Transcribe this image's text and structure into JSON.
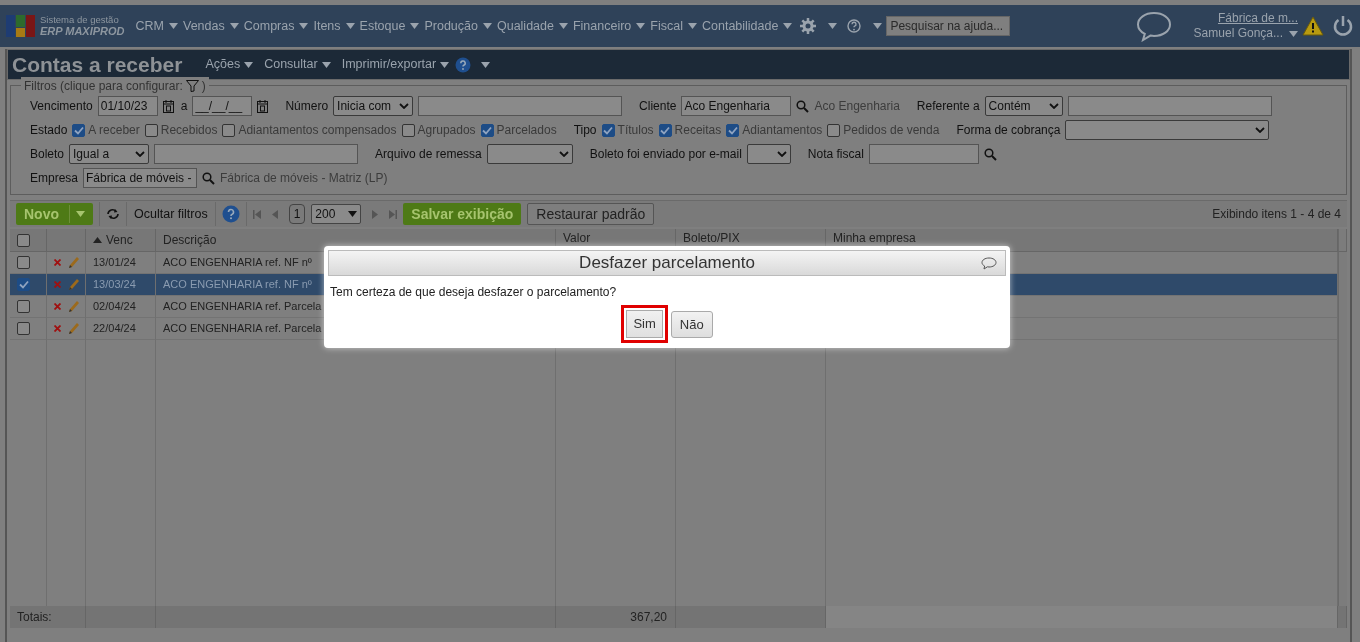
{
  "brand": {
    "line1": "Sistema de gestão",
    "line2": "ERP MAXIPROD"
  },
  "menu": [
    {
      "label": "CRM"
    },
    {
      "label": "Vendas"
    },
    {
      "label": "Compras"
    },
    {
      "label": "Itens"
    },
    {
      "label": "Estoque"
    },
    {
      "label": "Produção"
    },
    {
      "label": "Qualidade"
    },
    {
      "label": "Financeiro"
    },
    {
      "label": "Fiscal"
    },
    {
      "label": "Contabilidade"
    }
  ],
  "help_search": {
    "placeholder": "Pesquisar na ajuda..."
  },
  "account": {
    "company": "Fábrica de m...",
    "user": "Samuel Gonça..."
  },
  "page": {
    "title": "Contas a receber",
    "actions": [
      {
        "label": "Ações"
      },
      {
        "label": "Consultar"
      },
      {
        "label": "Imprimir/exportar"
      }
    ]
  },
  "filters": {
    "legend": "Filtros (clique para configurar:",
    "legend_end": ")",
    "lines": [
      {
        "items": [
          {
            "kind": "label",
            "text": "Vencimento"
          },
          {
            "kind": "date",
            "value": "01/10/23"
          },
          {
            "kind": "label",
            "text": "a"
          },
          {
            "kind": "date",
            "value": "__/__/__"
          },
          {
            "kind": "label",
            "text": "Número"
          },
          {
            "kind": "select",
            "value": "Inicia com"
          },
          {
            "kind": "input"
          },
          {
            "kind": "label",
            "text": "Cliente"
          },
          {
            "kind": "input",
            "value": "Aco Engenharia"
          },
          {
            "kind": "search"
          },
          {
            "kind": "text",
            "text": "Aco Engenharia"
          },
          {
            "kind": "label",
            "text": "Referente a"
          },
          {
            "kind": "select",
            "value": "Contém"
          },
          {
            "kind": "input"
          }
        ]
      },
      {
        "items": [
          {
            "kind": "label",
            "text": "Estado"
          },
          {
            "kind": "checkbox",
            "text": "A receber",
            "checked": true
          },
          {
            "kind": "checkbox",
            "text": "Recebidos",
            "checked": false
          },
          {
            "kind": "checkbox",
            "text": "Adiantamentos compensados",
            "checked": false
          },
          {
            "kind": "checkbox",
            "text": "Agrupados",
            "checked": false
          },
          {
            "kind": "checkbox",
            "text": "Parcelados",
            "checked": true
          },
          {
            "kind": "label",
            "text": "Tipo"
          },
          {
            "kind": "checkbox",
            "text": "Títulos",
            "checked": true
          },
          {
            "kind": "checkbox",
            "text": "Receitas",
            "checked": true
          },
          {
            "kind": "checkbox",
            "text": "Adiantamentos",
            "checked": true
          },
          {
            "kind": "checkbox",
            "text": "Pedidos de venda",
            "checked": false
          },
          {
            "kind": "label",
            "text": "Forma de cobrança"
          },
          {
            "kind": "select"
          }
        ]
      },
      {
        "items": [
          {
            "kind": "label",
            "text": "Boleto"
          },
          {
            "kind": "select",
            "value": "Igual a"
          },
          {
            "kind": "input"
          },
          {
            "kind": "label",
            "text": "Arquivo de remessa"
          },
          {
            "kind": "select"
          },
          {
            "kind": "label",
            "text": "Boleto foi enviado por e-mail"
          },
          {
            "kind": "select"
          },
          {
            "kind": "label",
            "text": "Nota fiscal"
          },
          {
            "kind": "input"
          },
          {
            "kind": "search"
          }
        ]
      },
      {
        "items": [
          {
            "kind": "label",
            "text": "Empresa"
          },
          {
            "kind": "input",
            "value": "Fábrica de móveis -"
          },
          {
            "kind": "search"
          },
          {
            "kind": "text",
            "text": "Fábrica de móveis - Matriz (LP)"
          }
        ]
      }
    ]
  },
  "toolbar": {
    "new": "Novo",
    "hide_filters": "Ocultar filtros",
    "page": "1",
    "page_size": "200",
    "save_view": "Salvar exibição",
    "restore": "Restaurar padrão",
    "status": "Exibindo itens 1 - 4 de 4"
  },
  "table": {
    "select_all_checked": false,
    "columns": [
      "Venc",
      "Descrição",
      "Valor",
      "Boleto/PIX",
      "Minha empresa"
    ],
    "rows": [
      {
        "selected": false,
        "due": "13/01/24",
        "description": "ACO ENGENHARIA ref. NF nº"
      },
      {
        "selected": true,
        "due": "13/03/24",
        "description": "ACO ENGENHARIA ref. NF nº"
      },
      {
        "selected": false,
        "due": "02/04/24",
        "description": "ACO ENGENHARIA ref. Parcela"
      },
      {
        "selected": false,
        "due": "22/04/24",
        "description": "ACO ENGENHARIA ref. Parcela"
      }
    ],
    "totals": {
      "label": "Totais:",
      "value": "367,20"
    }
  },
  "dialog": {
    "title": "Desfazer parcelamento",
    "message": "Tem certeza de que deseja desfazer o parcelamento?",
    "buttons": [
      {
        "label": "Sim",
        "highlighted": true
      },
      {
        "label": "Não",
        "highlighted": false
      }
    ]
  }
}
